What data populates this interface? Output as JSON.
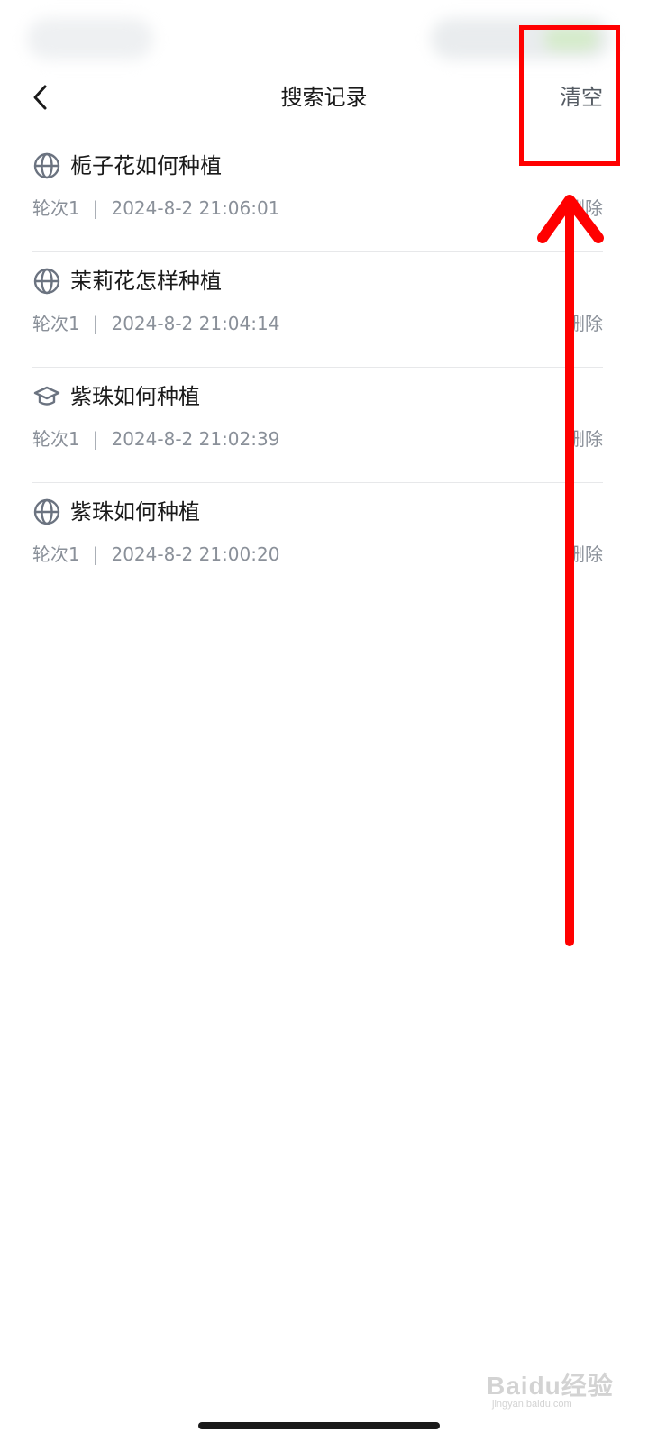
{
  "header": {
    "title": "搜索记录",
    "clear_label": "清空",
    "back_icon": "chevron-left-icon"
  },
  "records": [
    {
      "icon": "globe-icon",
      "title": "栀子花如何种植",
      "round": "轮次1",
      "separator": "|",
      "time": "2024-8-2 21:06:01",
      "delete_label": "删除"
    },
    {
      "icon": "globe-icon",
      "title": "茉莉花怎样种植",
      "round": "轮次1",
      "separator": "|",
      "time": "2024-8-2 21:04:14",
      "delete_label": "删除"
    },
    {
      "icon": "graduation-cap-icon",
      "title": "紫珠如何种植",
      "round": "轮次1",
      "separator": "|",
      "time": "2024-8-2 21:02:39",
      "delete_label": "删除"
    },
    {
      "icon": "globe-icon",
      "title": "紫珠如何种植",
      "round": "轮次1",
      "separator": "|",
      "time": "2024-8-2 21:00:20",
      "delete_label": "删除"
    }
  ],
  "annotation": {
    "highlight_color": "#ff0000",
    "arrow_color": "#ff0000"
  },
  "watermark": {
    "main": "Baidu经验",
    "sub": "jingyan.baidu.com"
  },
  "colors": {
    "text_primary": "#1a1a1a",
    "text_secondary": "#8a9099",
    "icon_gray": "#6b7380",
    "divider": "#e7e8ea"
  }
}
